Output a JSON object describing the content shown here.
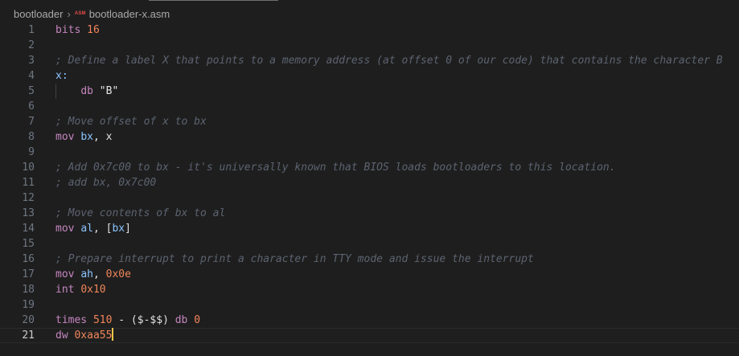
{
  "breadcrumb": {
    "folder": "bootloader",
    "separator": "›",
    "file_icon": "ASM",
    "file": "bootloader-x.asm"
  },
  "colors": {
    "background": "#1e1e1e",
    "keyword": "#c586c0",
    "number": "#f0855a",
    "register": "#8cc4ff",
    "comment": "#5c6370",
    "cursor": "#e8c547"
  },
  "lines": [
    {
      "n": "1",
      "tokens": [
        {
          "t": "bits ",
          "c": "kw"
        },
        {
          "t": "16",
          "c": "num"
        }
      ]
    },
    {
      "n": "2",
      "tokens": []
    },
    {
      "n": "3",
      "tokens": [
        {
          "t": "; Define a label X that points to a memory address (at offset 0 of our code) that contains the character B",
          "c": "cmt"
        }
      ]
    },
    {
      "n": "4",
      "tokens": [
        {
          "t": "x:",
          "c": "reg"
        }
      ]
    },
    {
      "n": "5",
      "indent": true,
      "tokens": [
        {
          "t": "    ",
          "c": "plain"
        },
        {
          "t": "db ",
          "c": "kw"
        },
        {
          "t": "\"B\"",
          "c": "str"
        }
      ]
    },
    {
      "n": "6",
      "tokens": []
    },
    {
      "n": "7",
      "tokens": [
        {
          "t": "; Move offset of x to bx",
          "c": "cmt"
        }
      ]
    },
    {
      "n": "8",
      "tokens": [
        {
          "t": "mov ",
          "c": "kw"
        },
        {
          "t": "bx",
          "c": "reg"
        },
        {
          "t": ", ",
          "c": "plain"
        },
        {
          "t": "x",
          "c": "plain"
        }
      ]
    },
    {
      "n": "9",
      "tokens": []
    },
    {
      "n": "10",
      "tokens": [
        {
          "t": "; Add 0x7c00 to bx - it's universally known that BIOS loads bootloaders to this location.",
          "c": "cmt"
        }
      ]
    },
    {
      "n": "11",
      "tokens": [
        {
          "t": "; add bx, 0x7c00",
          "c": "cmt"
        }
      ]
    },
    {
      "n": "12",
      "tokens": []
    },
    {
      "n": "13",
      "tokens": [
        {
          "t": "; Move contents of bx to al",
          "c": "cmt"
        }
      ]
    },
    {
      "n": "14",
      "tokens": [
        {
          "t": "mov ",
          "c": "kw"
        },
        {
          "t": "al",
          "c": "reg"
        },
        {
          "t": ", [",
          "c": "plain"
        },
        {
          "t": "bx",
          "c": "reg"
        },
        {
          "t": "]",
          "c": "plain"
        }
      ]
    },
    {
      "n": "15",
      "tokens": []
    },
    {
      "n": "16",
      "tokens": [
        {
          "t": "; Prepare interrupt to print a character in TTY mode and issue the interrupt",
          "c": "cmt"
        }
      ]
    },
    {
      "n": "17",
      "tokens": [
        {
          "t": "mov ",
          "c": "kw"
        },
        {
          "t": "ah",
          "c": "reg"
        },
        {
          "t": ", ",
          "c": "plain"
        },
        {
          "t": "0x0e",
          "c": "num"
        }
      ]
    },
    {
      "n": "18",
      "tokens": [
        {
          "t": "int ",
          "c": "kw"
        },
        {
          "t": "0x10",
          "c": "num"
        }
      ]
    },
    {
      "n": "19",
      "tokens": []
    },
    {
      "n": "20",
      "tokens": [
        {
          "t": "times ",
          "c": "kw"
        },
        {
          "t": "510",
          "c": "num"
        },
        {
          "t": " - ($-$$) ",
          "c": "plain"
        },
        {
          "t": "db ",
          "c": "kw"
        },
        {
          "t": "0",
          "c": "num"
        }
      ]
    },
    {
      "n": "21",
      "current": true,
      "cursor": true,
      "tokens": [
        {
          "t": "dw ",
          "c": "kw"
        },
        {
          "t": "0xaa55",
          "c": "num"
        }
      ]
    }
  ]
}
